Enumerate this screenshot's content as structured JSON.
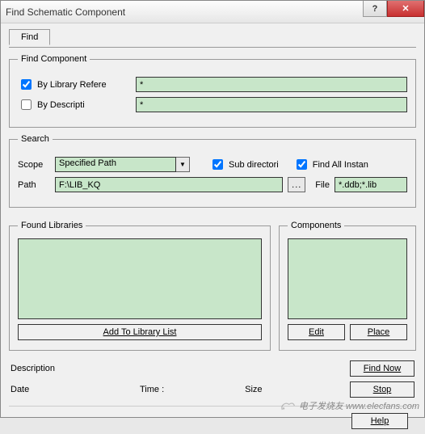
{
  "window": {
    "title": "Find Schematic Component"
  },
  "tab": {
    "label": "Find"
  },
  "findComponent": {
    "legend": "Find Component",
    "byLibRef": {
      "label": "By Library Refere",
      "checked": true,
      "value": "*"
    },
    "byDesc": {
      "label": "By Descripti",
      "checked": false,
      "value": "*"
    }
  },
  "search": {
    "legend": "Search",
    "scopeLabel": "Scope",
    "scopeValue": "Specified Path",
    "subdir": {
      "label": "Sub directori",
      "checked": true
    },
    "findAll": {
      "label": "Find All Instan",
      "checked": true
    },
    "pathLabel": "Path",
    "pathValue": "F:\\LIB_KQ",
    "fileLabel": "File",
    "fileValue": "*.ddb;*.lib"
  },
  "found": {
    "legend": "Found Libraries",
    "addBtn": "Add To Library List"
  },
  "components": {
    "legend": "Components",
    "editBtn": "Edit",
    "placeBtn": "Place"
  },
  "info": {
    "descLabel": "Description",
    "dateLabel": "Date",
    "timeLabel": "Time :",
    "sizeLabel": "Size"
  },
  "actions": {
    "findNow": "Find Now",
    "stop": "Stop",
    "help": "Help"
  },
  "watermark": "电子发烧友 www.elecfans.com"
}
